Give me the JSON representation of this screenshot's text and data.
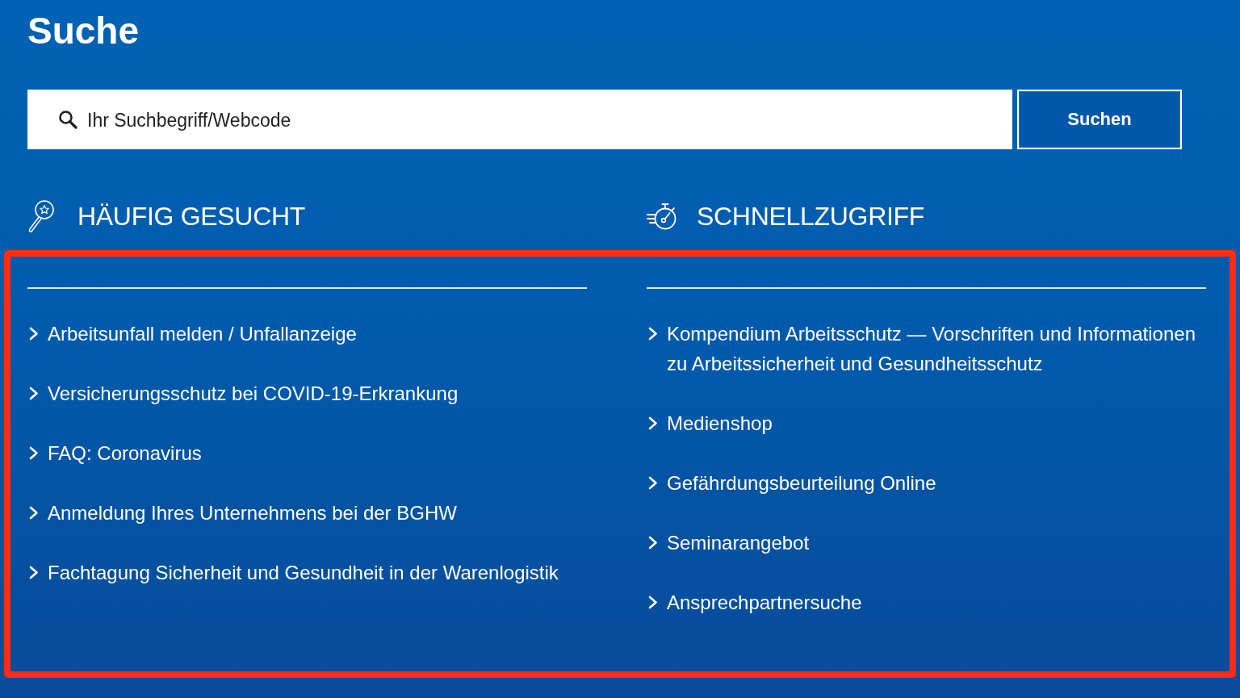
{
  "page_title": "Suche",
  "search": {
    "placeholder": "Ihr Suchbegriff/Webcode",
    "button": "Suchen"
  },
  "sections": [
    {
      "kind": "frequent",
      "heading": "HÄUFIG GESUCHT",
      "links": [
        "Arbeitsunfall melden / Unfallanzeige",
        "Versicherungsschutz bei COVID-19-Erkrankung",
        "FAQ: Coronavirus",
        "Anmeldung Ihres Unternehmens bei der BGHW",
        "Fachtagung Sicherheit und Gesundheit in der Warenlogistik"
      ]
    },
    {
      "kind": "quick-access",
      "heading": "SCHNELLZUGRIFF",
      "links": [
        "Kompendium Arbeitsschutz — Vorschriften und Informationen zu Arbeitssicherheit und Gesundheitsschutz",
        "Medienshop",
        "Gefährdungsbeurteilung Online",
        "Seminarangebot",
        "Ansprechpartnersuche"
      ]
    }
  ]
}
